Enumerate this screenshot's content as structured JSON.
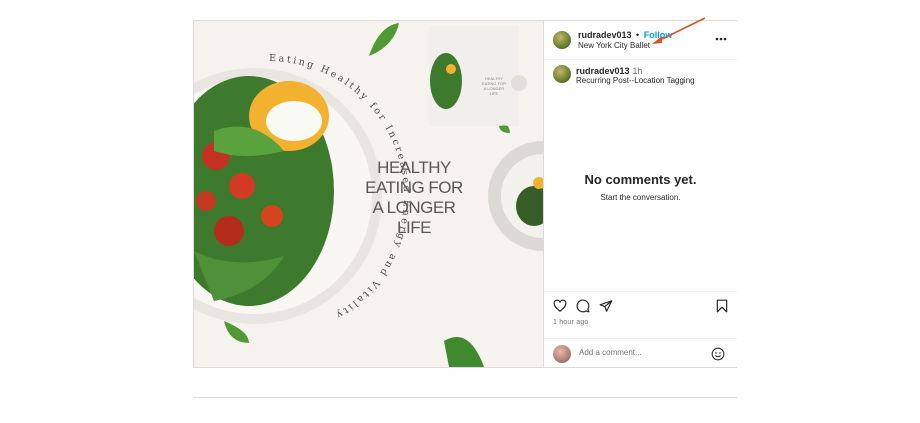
{
  "post": {
    "username": "rudradev013",
    "follow_label": "Follow",
    "dot": "•",
    "location": "New York City Ballet",
    "more_label": "•••",
    "caption": {
      "username": "rudradev013",
      "time": "1h",
      "text": "Recurring Post--Location Tagging"
    },
    "empty_title": "No comments yet.",
    "empty_subtitle": "Start the conversation.",
    "time_ago": "1 hour ago",
    "comment_placeholder": "Add a comment..."
  },
  "media": {
    "title_lines": [
      "HEALTHY",
      "EATING FOR",
      "A LONGER",
      "LIFE"
    ],
    "circular_text": "Eating Healthy for Increased Energy and Vitality",
    "mini_title": [
      "HEALTHY",
      "EATING FOR",
      "A LONGER",
      "LIFE"
    ]
  },
  "icons": {
    "like": "heart-icon",
    "comment": "comment-icon",
    "share": "share-icon",
    "save": "bookmark-icon",
    "emoji": "emoji-icon",
    "more": "more-icon"
  },
  "colors": {
    "follow": "#0095f6",
    "arrow": "#d2562a",
    "media_bg": "#f6f3ef"
  }
}
